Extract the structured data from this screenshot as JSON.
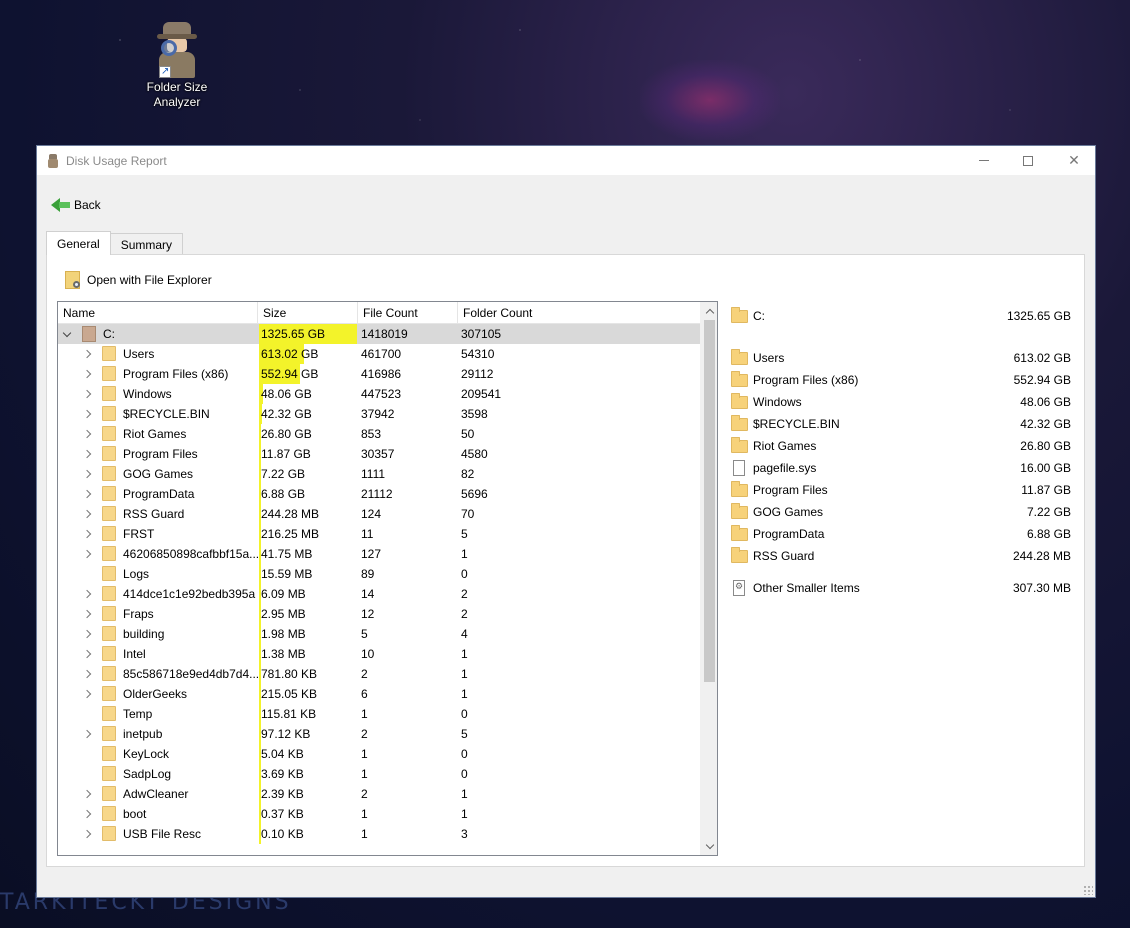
{
  "desktop": {
    "icon_label_line1": "Folder Size",
    "icon_label_line2": "Analyzer",
    "watermark": "TARKITECKT DESIGNS"
  },
  "window": {
    "title": "Disk Usage Report",
    "back_label": "Back",
    "tabs": [
      {
        "label": "General",
        "active": true
      },
      {
        "label": "Summary",
        "active": false
      }
    ],
    "open_explorer_label": "Open with File Explorer"
  },
  "tree": {
    "columns": [
      "Name",
      "Size",
      "File Count",
      "Folder Count"
    ],
    "rows": [
      {
        "name": "C:",
        "size": "1325.65 GB",
        "files": "1418019",
        "folders": "307105",
        "level": 0,
        "expanded": true,
        "drive": true,
        "share": 1.0,
        "selected": true
      },
      {
        "name": "Users",
        "size": "613.02 GB",
        "files": "461700",
        "folders": "54310",
        "level": 1,
        "expander": true,
        "share": 0.4624
      },
      {
        "name": "Program Files (x86)",
        "size": "552.94 GB",
        "files": "416986",
        "folders": "29112",
        "level": 1,
        "expander": true,
        "share": 0.4171
      },
      {
        "name": "Windows",
        "size": "48.06 GB",
        "files": "447523",
        "folders": "209541",
        "level": 1,
        "expander": true,
        "share": 0.0363
      },
      {
        "name": "$RECYCLE.BIN",
        "size": "42.32 GB",
        "files": "37942",
        "folders": "3598",
        "level": 1,
        "expander": true,
        "share": 0.0319
      },
      {
        "name": "Riot Games",
        "size": "26.80 GB",
        "files": "853",
        "folders": "50",
        "level": 1,
        "expander": true,
        "share": 0.0202
      },
      {
        "name": "Program Files",
        "size": "11.87 GB",
        "files": "30357",
        "folders": "4580",
        "level": 1,
        "expander": true,
        "share": 0.009
      },
      {
        "name": "GOG Games",
        "size": "7.22 GB",
        "files": "1111",
        "folders": "82",
        "level": 1,
        "expander": true,
        "share": 0.0054
      },
      {
        "name": "ProgramData",
        "size": "6.88 GB",
        "files": "21112",
        "folders": "5696",
        "level": 1,
        "expander": true,
        "share": 0.0052
      },
      {
        "name": "RSS Guard",
        "size": "244.28 MB",
        "files": "124",
        "folders": "70",
        "level": 1,
        "expander": true,
        "share": 0.0002
      },
      {
        "name": "FRST",
        "size": "216.25 MB",
        "files": "11",
        "folders": "5",
        "level": 1,
        "expander": true,
        "share": 0.0002
      },
      {
        "name": "46206850898cafbbf15a...",
        "size": "41.75 MB",
        "files": "127",
        "folders": "1",
        "level": 1,
        "expander": true,
        "share": 0
      },
      {
        "name": "Logs",
        "size": "15.59 MB",
        "files": "89",
        "folders": "0",
        "level": 1,
        "expander": false,
        "share": 0
      },
      {
        "name": "414dce1c1e92bedb395a",
        "size": "6.09 MB",
        "files": "14",
        "folders": "2",
        "level": 1,
        "expander": true,
        "share": 0
      },
      {
        "name": "Fraps",
        "size": "2.95 MB",
        "files": "12",
        "folders": "2",
        "level": 1,
        "expander": true,
        "share": 0
      },
      {
        "name": "building",
        "size": "1.98 MB",
        "files": "5",
        "folders": "4",
        "level": 1,
        "expander": true,
        "share": 0
      },
      {
        "name": "Intel",
        "size": "1.38 MB",
        "files": "10",
        "folders": "1",
        "level": 1,
        "expander": true,
        "share": 0
      },
      {
        "name": "85c586718e9ed4db7d4...",
        "size": "781.80 KB",
        "files": "2",
        "folders": "1",
        "level": 1,
        "expander": true,
        "share": 0
      },
      {
        "name": "OlderGeeks",
        "size": "215.05 KB",
        "files": "6",
        "folders": "1",
        "level": 1,
        "expander": true,
        "share": 0
      },
      {
        "name": "Temp",
        "size": "115.81 KB",
        "files": "1",
        "folders": "0",
        "level": 1,
        "expander": false,
        "share": 0
      },
      {
        "name": "inetpub",
        "size": "97.12 KB",
        "files": "2",
        "folders": "5",
        "level": 1,
        "expander": true,
        "share": 0
      },
      {
        "name": "KeyLock",
        "size": "5.04 KB",
        "files": "1",
        "folders": "0",
        "level": 1,
        "expander": false,
        "share": 0
      },
      {
        "name": "SadpLog",
        "size": "3.69 KB",
        "files": "1",
        "folders": "0",
        "level": 1,
        "expander": false,
        "share": 0
      },
      {
        "name": "AdwCleaner",
        "size": "2.39 KB",
        "files": "2",
        "folders": "1",
        "level": 1,
        "expander": true,
        "share": 0
      },
      {
        "name": "boot",
        "size": "0.37 KB",
        "files": "1",
        "folders": "1",
        "level": 1,
        "expander": true,
        "share": 0
      },
      {
        "name": "USB File Resc",
        "size": "0.10 KB",
        "files": "1",
        "folders": "3",
        "level": 1,
        "expander": true,
        "share": 0
      }
    ]
  },
  "summary": {
    "drive": {
      "name": "C:",
      "size": "1325.65 GB"
    },
    "items": [
      {
        "name": "Users",
        "size": "613.02 GB",
        "icon": "folder-icon"
      },
      {
        "name": "Program Files (x86)",
        "size": "552.94 GB",
        "icon": "folder-icon"
      },
      {
        "name": "Windows",
        "size": "48.06 GB",
        "icon": "folder-icon"
      },
      {
        "name": "$RECYCLE.BIN",
        "size": "42.32 GB",
        "icon": "folder-icon"
      },
      {
        "name": "Riot Games",
        "size": "26.80 GB",
        "icon": "folder-icon"
      },
      {
        "name": "pagefile.sys",
        "size": "16.00 GB",
        "icon": "file-icon"
      },
      {
        "name": "Program Files",
        "size": "11.87 GB",
        "icon": "folder-icon"
      },
      {
        "name": "GOG Games",
        "size": "7.22 GB",
        "icon": "folder-icon"
      },
      {
        "name": "ProgramData",
        "size": "6.88 GB",
        "icon": "folder-icon"
      },
      {
        "name": "RSS Guard",
        "size": "244.28 MB",
        "icon": "folder-icon"
      }
    ],
    "other": {
      "name": "Other Smaller Items",
      "size": "307.30 MB",
      "icon": "gear-file-icon"
    }
  },
  "colors": {
    "size_bar": "#f3f32a",
    "selected_row": "#d9d9d9"
  }
}
